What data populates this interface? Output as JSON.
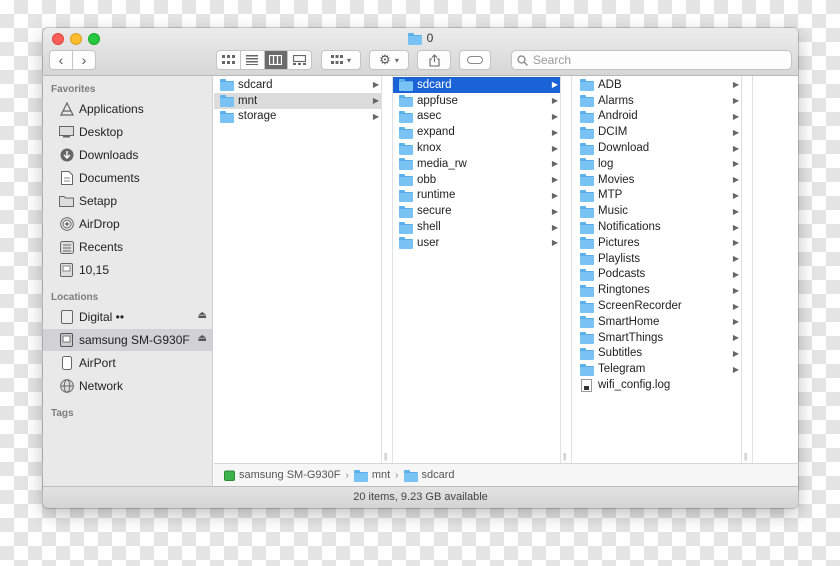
{
  "window": {
    "title": "0",
    "nav": {
      "back": "‹",
      "forward": "›"
    },
    "search_placeholder": "Search",
    "status": "20 items, 9.23 GB available"
  },
  "sidebar": {
    "favorites_label": "Favorites",
    "favorites": [
      {
        "label": "Applications",
        "icon": "applications-icon"
      },
      {
        "label": "Desktop",
        "icon": "desktop-icon"
      },
      {
        "label": "Downloads",
        "icon": "downloads-icon"
      },
      {
        "label": "Documents",
        "icon": "documents-icon"
      },
      {
        "label": "Setapp",
        "icon": "folder-icon"
      },
      {
        "label": "AirDrop",
        "icon": "airdrop-icon"
      },
      {
        "label": "Recents",
        "icon": "recents-icon"
      },
      {
        "label": "10,15",
        "icon": "disk-icon"
      }
    ],
    "locations_label": "Locations",
    "locations": [
      {
        "label": "Digital ••",
        "icon": "drive-icon",
        "eject": "⏏"
      },
      {
        "label": "samsung SM-G930F",
        "icon": "phone-drive-icon",
        "eject": "⏏"
      },
      {
        "label": "AirPort",
        "icon": "airport-icon"
      },
      {
        "label": "Network",
        "icon": "network-icon"
      }
    ],
    "tags_label": "Tags"
  },
  "columns": {
    "col1": [
      "sdcard",
      "mnt",
      "storage"
    ],
    "col2": [
      "sdcard",
      "appfuse",
      "asec",
      "expand",
      "knox",
      "media_rw",
      "obb",
      "runtime",
      "secure",
      "shell",
      "user"
    ],
    "col3": [
      "ADB",
      "Alarms",
      "Android",
      "DCIM",
      "Download",
      "log",
      "Movies",
      "MTP",
      "Music",
      "Notifications",
      "Pictures",
      "Playlists",
      "Podcasts",
      "Ringtones",
      "ScreenRecorder",
      "SmartHome",
      "SmartThings",
      "Subtitles",
      "Telegram",
      "wifi_config.log"
    ]
  },
  "pathbar": [
    "samsung SM-G930F",
    "mnt",
    "sdcard"
  ],
  "colors": {
    "selection_blue": "#1a62d6",
    "folder_blue": "#79c3f4",
    "close": "#fc5f57",
    "minimize": "#fdbc2e",
    "zoom": "#27c840"
  }
}
